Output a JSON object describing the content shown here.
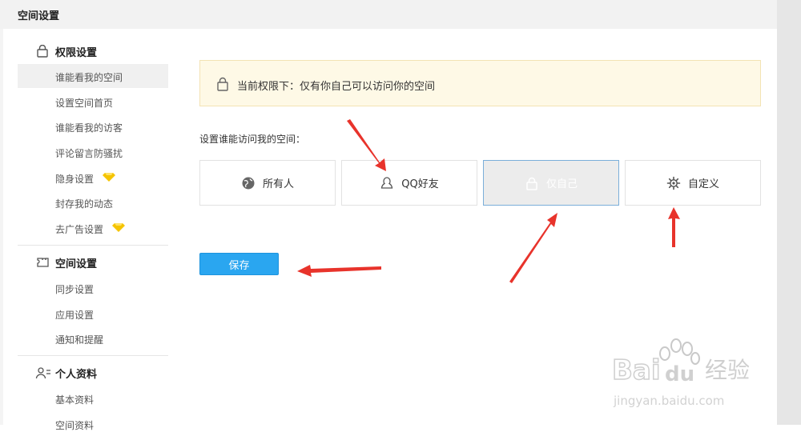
{
  "header": {
    "title": "空间设置"
  },
  "sidebar": {
    "sections": [
      {
        "title": "权限设置",
        "icon": "lock-icon",
        "items": [
          {
            "label": "谁能看我的空间",
            "active": true
          },
          {
            "label": "设置空间首页"
          },
          {
            "label": "谁能看我的访客"
          },
          {
            "label": "评论留言防骚扰"
          },
          {
            "label": "隐身设置",
            "badge": "diamond-icon"
          },
          {
            "label": "封存我的动态"
          },
          {
            "label": "去广告设置",
            "badge": "diamond-icon"
          }
        ]
      },
      {
        "title": "空间设置",
        "icon": "puzzle-icon",
        "items": [
          {
            "label": "同步设置"
          },
          {
            "label": "应用设置"
          },
          {
            "label": "通知和提醒"
          }
        ]
      },
      {
        "title": "个人资料",
        "icon": "user-card-icon",
        "items": [
          {
            "label": "基本资料"
          },
          {
            "label": "空间资料"
          }
        ]
      }
    ]
  },
  "notice": {
    "text": "当前权限下：仅有你自己可以访问你的空间",
    "icon": "lock-icon"
  },
  "prompt": "设置谁能访问我的空间：",
  "options": [
    {
      "label": "所有人",
      "icon": "globe-icon"
    },
    {
      "label": "QQ好友",
      "icon": "friend-icon"
    },
    {
      "label": "仅自己",
      "icon": "lock-icon",
      "selected": true
    },
    {
      "label": "自定义",
      "icon": "gear-icon"
    }
  ],
  "save_label": "保存",
  "watermark": {
    "logo": "Bai du 经验",
    "url": "jingyan.baidu.com"
  },
  "colors": {
    "accent": "#2aa6f0",
    "annotation_arrow": "#e8332b",
    "notice_bg": "#fef9e6"
  }
}
